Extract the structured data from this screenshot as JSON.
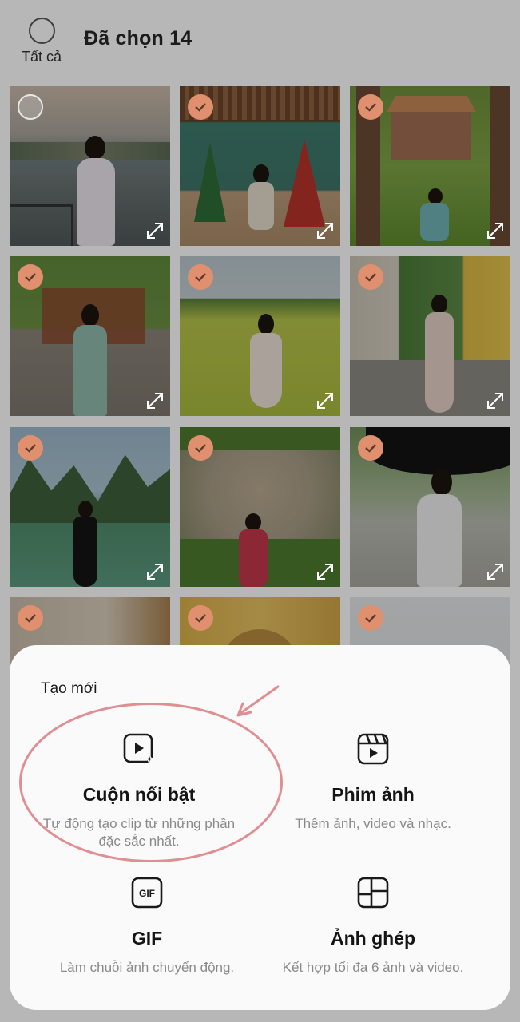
{
  "header": {
    "select_all_label": "Tất cả",
    "title": "Đã chọn 14"
  },
  "grid": {
    "selected_count": 14,
    "tiles": [
      {
        "selected": false
      },
      {
        "selected": true
      },
      {
        "selected": true
      },
      {
        "selected": true
      },
      {
        "selected": true
      },
      {
        "selected": true
      },
      {
        "selected": true
      },
      {
        "selected": true
      },
      {
        "selected": true
      },
      {
        "selected": true
      },
      {
        "selected": true
      },
      {
        "selected": true
      }
    ]
  },
  "sheet": {
    "title": "Tạo mới",
    "options": [
      {
        "icon": "highlight-reel-icon",
        "title": "Cuộn nổi bật",
        "desc_line1": "Tự động tạo clip từ những phần",
        "desc_line2": "đặc sắc nhất."
      },
      {
        "icon": "movie-clapper-icon",
        "title": "Phim ảnh",
        "desc_line1": "Thêm ảnh, video và nhạc.",
        "desc_line2": ""
      },
      {
        "icon": "gif-icon",
        "title": "GIF",
        "desc_line1": "Làm chuỗi ảnh chuyển động.",
        "desc_line2": ""
      },
      {
        "icon": "collage-icon",
        "title": "Ảnh ghép",
        "desc_line1": "Kết hợp tối đa 6 ảnh và video.",
        "desc_line2": ""
      }
    ]
  },
  "colors": {
    "check_accent": "#e0906f",
    "annotation": "#e08e92",
    "sheet_bg": "#fafafa"
  }
}
